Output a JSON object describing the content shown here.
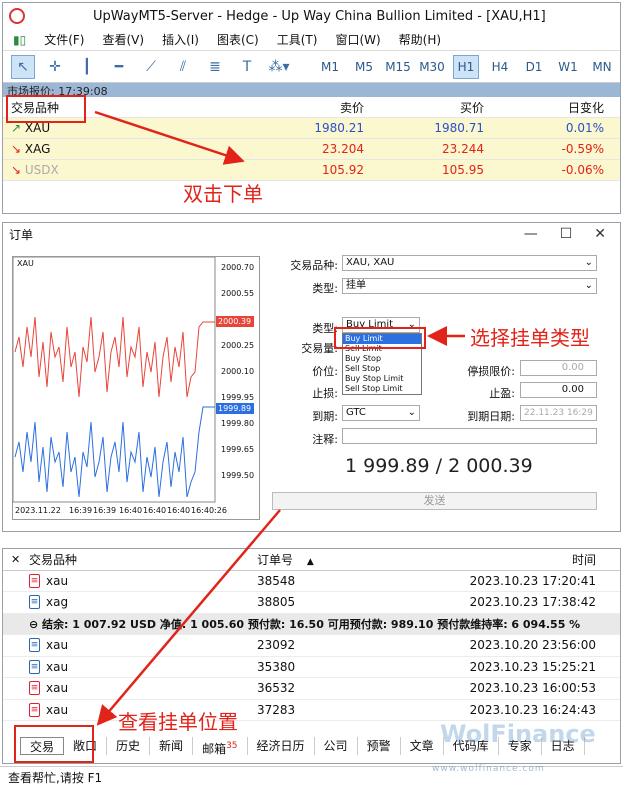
{
  "window": {
    "title": "UpWayMT5-Server - Hedge - Up Way China Bullion Limited - [XAU,H1]"
  },
  "menu": [
    "文件(F)",
    "查看(V)",
    "插入(I)",
    "图表(C)",
    "工具(T)",
    "窗口(W)",
    "帮助(H)"
  ],
  "timeframes": [
    "M1",
    "M5",
    "M15",
    "M30",
    "H1",
    "H4",
    "D1",
    "W1",
    "MN"
  ],
  "market_watch": {
    "header": "市场报价: 17:39:08",
    "columns": [
      "交易品种",
      "卖价",
      "买价",
      "日变化"
    ],
    "rows": [
      {
        "symbol": "XAU",
        "bid": "1980.21",
        "ask": "1980.71",
        "change": "0.01%",
        "dir": "up",
        "color": "#2a4fc9"
      },
      {
        "symbol": "XAG",
        "bid": "23.204",
        "ask": "23.244",
        "change": "-0.59%",
        "dir": "down",
        "color": "#e2231a"
      },
      {
        "symbol": "USDX",
        "bid": "105.92",
        "ask": "105.95",
        "change": "-0.06%",
        "dir": "down",
        "color": "#e2231a"
      }
    ]
  },
  "annotations": {
    "double_click": "双击下单",
    "choose_type": "选择挂单类型",
    "view_position": "查看挂单位置"
  },
  "order_dialog": {
    "title": "订单",
    "chart": {
      "symbol": "XAU",
      "price_labels": [
        "2000.70",
        "2000.55",
        "2000.39",
        "2000.25",
        "2000.10",
        "1999.95",
        "1999.89",
        "1999.80",
        "1999.65",
        "1999.50"
      ],
      "time_labels": [
        "2023.11.22",
        "16:39",
        "16:39",
        "16:40",
        "16:40",
        "16:40",
        "16:40:26"
      ]
    },
    "labels": {
      "symbol": "交易品种:",
      "type": "类型:",
      "kind": "类型:",
      "volume": "交易量:",
      "price": "价位:",
      "sl": "止损:",
      "expiry": "到期:",
      "stoplimit": "停损限价:",
      "tp": "止盈:",
      "expiry_date": "到期日期:",
      "comment": "注释:"
    },
    "symbol_value": "XAU, XAU",
    "type_value": "挂单",
    "kind_value": "Buy Limit",
    "dropdown_options": [
      "Buy Limit",
      "Sell Limit",
      "Buy Stop",
      "Sell Stop",
      "Buy Stop Limit",
      "Sell Stop Limit"
    ],
    "stoplimit_value": "0.00",
    "tp_value": "0.00",
    "expiry_value": "GTC",
    "expiry_date_value": "22.11.23 16:29",
    "prices": "1 999.89 / 2 000.39",
    "send_label": "发送"
  },
  "toolbox": {
    "columns": [
      "交易品种",
      "订单号",
      "时间"
    ],
    "rows_top": [
      {
        "symbol": "xau",
        "ticket": "38548",
        "time": "2023.10.23 17:20:41",
        "icon": "r"
      },
      {
        "symbol": "xag",
        "ticket": "38805",
        "time": "2023.10.23 17:38:42",
        "icon": "b"
      }
    ],
    "balance": "⊖ 结余: 1 007.92 USD 净值: 1 005.60 预付款: 16.50 可用预付款: 989.10 预付款维持率: 6 094.55 %",
    "rows_bottom": [
      {
        "symbol": "xau",
        "ticket": "23092",
        "time": "2023.10.20 23:56:00",
        "icon": "b"
      },
      {
        "symbol": "xau",
        "ticket": "35380",
        "time": "2023.10.23 15:25:21",
        "icon": "b"
      },
      {
        "symbol": "xau",
        "ticket": "36532",
        "time": "2023.10.23 16:00:53",
        "icon": "r"
      },
      {
        "symbol": "xau",
        "ticket": "37283",
        "time": "2023.10.23 16:24:43",
        "icon": "r"
      }
    ],
    "tabs": [
      "交易",
      "敞口",
      "历史",
      "新闻",
      "邮箱",
      "经济日历",
      "公司",
      "预警",
      "文章",
      "代码库",
      "专家",
      "日志"
    ],
    "mail_count": "35"
  },
  "status": "查看帮忙,请按 F1",
  "watermark": "WolFinance",
  "watermark_url": "www.wolfinance.com"
}
